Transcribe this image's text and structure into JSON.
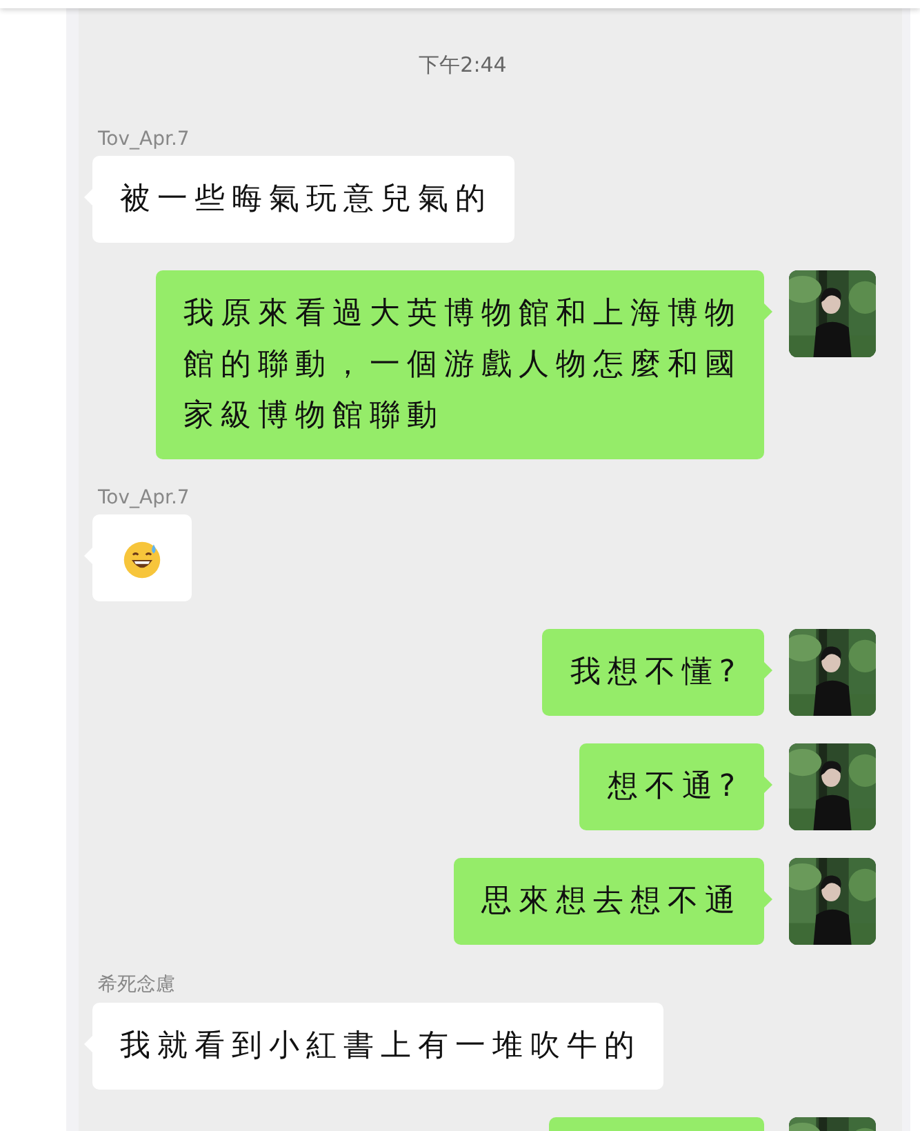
{
  "timestamp": "下午2:44",
  "messages": [
    {
      "kind": "in_text",
      "sender": "Tov_Apr.7",
      "text": "被一些晦氣玩意兒氣的"
    },
    {
      "kind": "out_text",
      "text": "我原來看過大英博物館和上海博物館的聯動，一個游戲人物怎麼和國家級博物館聯動"
    },
    {
      "kind": "in_emoji",
      "sender": "Tov_Apr.7"
    },
    {
      "kind": "out_text",
      "text": "我想不懂?"
    },
    {
      "kind": "out_text",
      "text": "想不通?"
    },
    {
      "kind": "out_text",
      "text": "思來想去想不通"
    },
    {
      "kind": "in_text",
      "sender": "希死念慮",
      "text": "我就看到小紅書上有一堆吹牛的"
    },
    {
      "kind": "out_partial"
    }
  ]
}
